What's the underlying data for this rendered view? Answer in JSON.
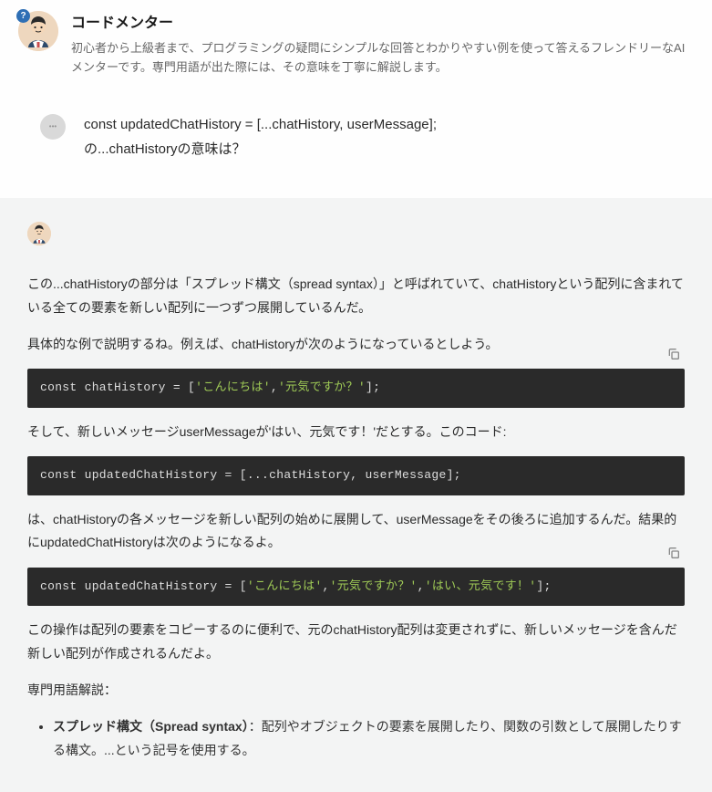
{
  "header": {
    "bot_name": "コードメンター",
    "bot_desc": "初心者から上級者まで、プログラミングの疑問にシンプルな回答とわかりやすい例を使って答えるフレンドリーなAIメンターです。専門用語が出た際には、その意味を丁寧に解説します。",
    "badge": "?"
  },
  "user": {
    "line1": "const updatedChatHistory = [...chatHistory, userMessage];",
    "line2": "の...chatHistoryの意味は？"
  },
  "assistant": {
    "p1": "この...chatHistoryの部分は「スプレッド構文（spread syntax）」と呼ばれていて、chatHistoryという配列に含まれている全ての要素を新しい配列に一つずつ展開しているんだ。",
    "p2": "具体的な例で説明するね。例えば、chatHistoryが次のようになっているとしよう。",
    "code1_pre": "const chatHistory = [",
    "code1_s1": "'こんにちは'",
    "code1_sep": ",",
    "code1_s2": "'元気ですか？'",
    "code1_post": "];",
    "p3": "そして、新しいメッセージuserMessageが'はい、元気です！'だとする。このコード:",
    "code2": "const updatedChatHistory = [...chatHistory, userMessage];",
    "p4": "は、chatHistoryの各メッセージを新しい配列の始めに展開して、userMessageをその後ろに追加するんだ。結果的にupdatedChatHistoryは次のようになるよ。",
    "code3_pre": "const updatedChatHistory = [",
    "code3_s1": "'こんにちは'",
    "code3_s2": "'元気ですか？'",
    "code3_s3": "'はい、元気です！'",
    "code3_post": "];",
    "p5": "この操作は配列の要素をコピーするのに便利で、元のchatHistory配列は変更されずに、新しいメッセージを含んだ新しい配列が作成されるんだよ。",
    "terms_head": "専門用語解説：",
    "term1_label": "スプレッド構文（Spread syntax）",
    "term1_desc": "：配列やオブジェクトの要素を展開したり、関数の引数として展開したりする構文。...という記号を使用する。"
  }
}
